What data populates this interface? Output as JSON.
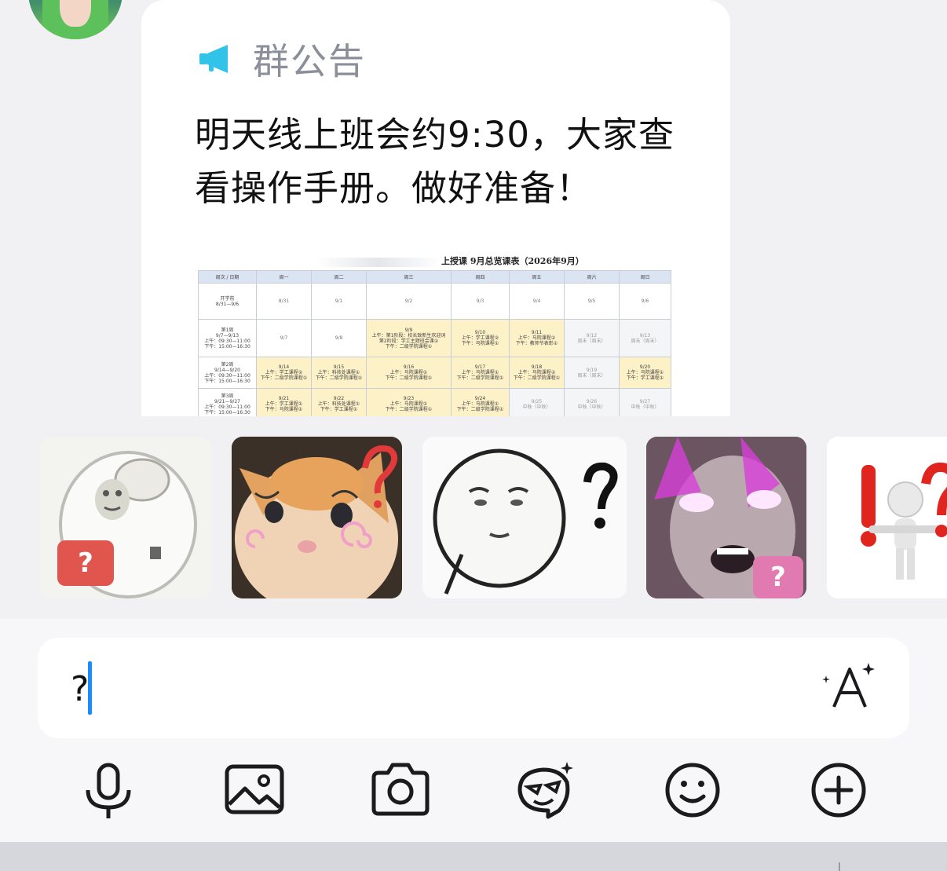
{
  "notice": {
    "title": "群公告",
    "body_line1": "明天线上班会约9:30，大家查",
    "body_line2": "看操作手册。做好准备！",
    "schedule": {
      "title": "上授课 9月总览课表（2026年9月）",
      "columns": [
        "周次 / 日期",
        "周一",
        "周二",
        "周三",
        "周四",
        "周五",
        "周六",
        "周日"
      ],
      "rows": [
        {
          "label": "开学前\n8/31—9/6",
          "cells": [
            "8/31",
            "9/1",
            "9/2",
            "9/3",
            "9/4",
            "9/5",
            "9/6"
          ]
        },
        {
          "label": "第1周\n9/7—9/13\n上午：09:30—11:00\n下午：15:00—16:30",
          "cells": [
            "9/7",
            "9/8",
            "9/9\n上午：第1阶段：校长致新生欢迎词\n第2阶段：学工主题班会课②\n下午：二级学院课程①",
            "9/10\n上午：学工课程②\n下午：马院课程①",
            "9/11\n上午：马院课程②\n下午：教师节表彰①",
            "9/12\n周末（周末）",
            "9/13\n周末（周末）"
          ]
        },
        {
          "label": "第2周\n9/14—9/20\n上午：09:30—11:00\n下午：15:00—16:30",
          "cells": [
            "9/14\n上午：学工课程②\n下午：二级学院课程①",
            "9/15\n上午：科技处课程①\n下午：二级学院课程①",
            "9/16\n上午：马院课程①\n下午：二级学院课程①",
            "9/17\n上午：马院课程①\n下午：二级学院课程①",
            "9/18\n上午：马院课程②\n下午：二级学院课程①",
            "9/19\n周末（周末）",
            "9/20\n上午：马院课程①\n下午：学工课程①"
          ]
        },
        {
          "label": "第3周\n9/21—9/27\n上午：09:30—11:00\n下午：15:00—16:30",
          "cells": [
            "9/21\n上午：学工课程①\n下午：马院课程①",
            "9/22\n上午：科技处课程①\n下午：学工课程①",
            "9/23\n上午：马院课程①\n下午：二级学院课程①",
            "9/24\n上午：马院课程①\n下午：二级学院课程①",
            "9/25\n中秋（中秋）",
            "9/26\n中秋（中秋）",
            "9/27\n中秋（中秋）"
          ]
        }
      ]
    }
  },
  "stickers": [
    {
      "name": "sticker-meme-blob",
      "badge": "?",
      "badge_color": "#e0554e"
    },
    {
      "name": "sticker-confused-kitten",
      "badge": "",
      "badge_color": ""
    },
    {
      "name": "sticker-sketch-face-question",
      "badge": "",
      "badge_color": ""
    },
    {
      "name": "sticker-glowing-eyes",
      "badge": "?",
      "badge_color": "#e27ab2"
    },
    {
      "name": "sticker-3d-figure-exclaim-question",
      "badge": "",
      "badge_color": ""
    }
  ],
  "input": {
    "value": "?"
  },
  "toolbar": [
    "microphone-icon",
    "image-icon",
    "camera-icon",
    "sticker-face-icon",
    "emoji-icon",
    "plus-circle-icon"
  ],
  "colors": {
    "accent": "#1a8cff",
    "megaphone": "#33c2e8",
    "icon": "#1b1b1f"
  }
}
